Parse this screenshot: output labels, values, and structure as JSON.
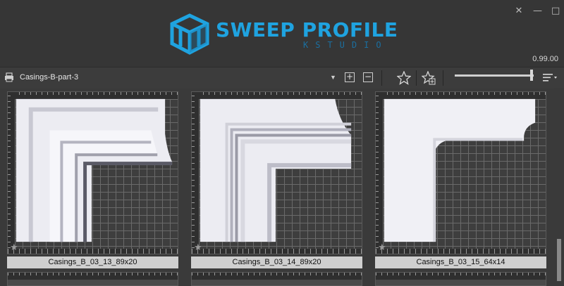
{
  "app": {
    "logo_title": "SWEEP PROFILE",
    "logo_subtitle": "KSTUDIO",
    "version": "0.99.00",
    "accent_color": "#1fa3e0"
  },
  "window_controls": [
    {
      "name": "close-icon",
      "glyph": "✕"
    },
    {
      "name": "minimize-icon",
      "glyph": "—"
    },
    {
      "name": "maximize-icon",
      "glyph": "□"
    }
  ],
  "toolbar": {
    "library_name": "Casings-B-part-3",
    "icons": [
      "print-icon",
      "dropdown-arrow-icon",
      "add-icon",
      "remove-icon",
      "star-icon",
      "star-add-icon",
      "sort-icon"
    ],
    "zoom_level_fraction": 0.97
  },
  "items": [
    {
      "label": "Casings_B_03_13_89x20",
      "favorite": false
    },
    {
      "label": "Casings_B_03_14_89x20",
      "favorite": false
    },
    {
      "label": "Casings_B_03_15_64x14",
      "favorite": false
    }
  ],
  "scrollbar": {
    "position_fraction": 1.0
  }
}
